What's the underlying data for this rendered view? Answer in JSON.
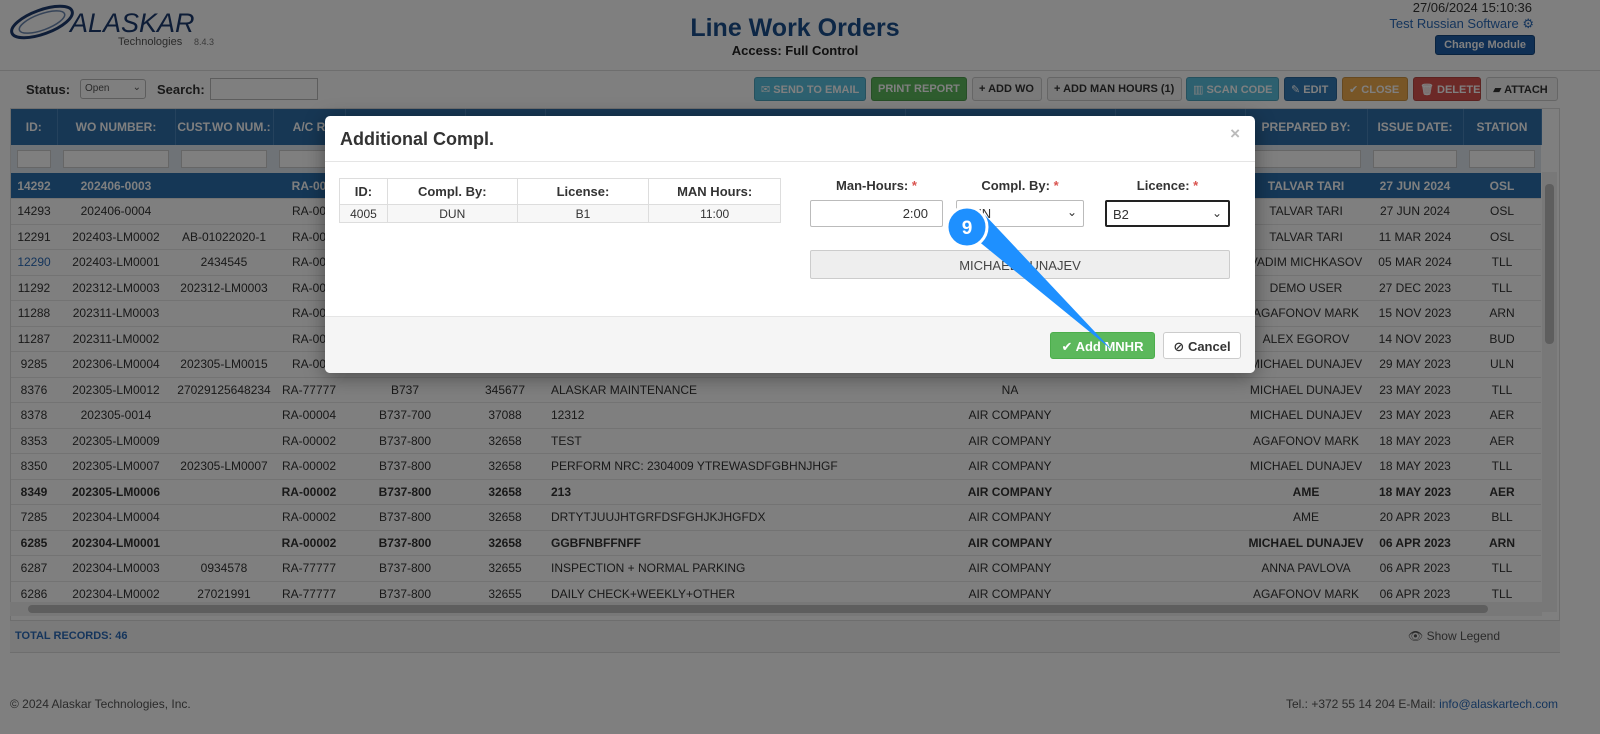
{
  "header": {
    "brand": "ALASKAR",
    "brand_sub": "Technologies",
    "version": "8.4.3",
    "title": "Line Work Orders",
    "access": "Access: Full Control",
    "datetime": "27/06/2024 15:10:36",
    "company": "Test Russian Software",
    "change_module": "Change Module"
  },
  "toolbar": {
    "status_label": "Status:",
    "status_value": "Open",
    "search_label": "Search:",
    "search_value": "",
    "send_email": "SEND TO EMAIL",
    "print_report": "PRINT REPORT",
    "add_wo": "ADD WO",
    "add_man_hours": "ADD MAN HOURS (1)",
    "scan_code": "SCAN CODE",
    "edit": "EDIT",
    "close": "CLOSE",
    "delete": "DELETE",
    "attach": "ATTACH"
  },
  "grid": {
    "columns": [
      "ID:",
      "WO NUMBER:",
      "CUST.WO NUM.:",
      "A/C R",
      "",
      "",
      "",
      "",
      "",
      "PREPARED BY:",
      "ISSUE DATE:",
      "STATION"
    ],
    "rows": [
      {
        "id": "14292",
        "wo": "202406-0003",
        "cust": "",
        "reg": "RA-00",
        "type": "",
        "msn": "",
        "desc": "",
        "company": "",
        "prepared": "TALVAR TARI",
        "date": "27 JUN 2024",
        "station": "OSL",
        "style": "selected"
      },
      {
        "id": "14293",
        "wo": "202406-0004",
        "cust": "",
        "reg": "RA-00",
        "type": "",
        "msn": "",
        "desc": "",
        "company": "",
        "prepared": "TALVAR TARI",
        "date": "27 JUN 2024",
        "station": "OSL",
        "style": ""
      },
      {
        "id": "12291",
        "wo": "202403-LM0002",
        "cust": "AB-01022020-1",
        "reg": "RA-00",
        "type": "",
        "msn": "",
        "desc": "",
        "company": "",
        "prepared": "TALVAR TARI",
        "date": "11 MAR 2024",
        "station": "OSL",
        "style": ""
      },
      {
        "id": "12290",
        "wo": "202403-LM0001",
        "cust": "2434545",
        "reg": "RA-00",
        "type": "",
        "msn": "",
        "desc": "",
        "company": "",
        "prepared": "VADIM MICHKASOV",
        "date": "05 MAR 2024",
        "station": "TLL",
        "style": "link"
      },
      {
        "id": "11292",
        "wo": "202312-LM0003",
        "cust": "202312-LM0003",
        "reg": "RA-00",
        "type": "",
        "msn": "",
        "desc": "",
        "company": "",
        "prepared": "DEMO USER",
        "date": "27 DEC 2023",
        "station": "TLL",
        "style": ""
      },
      {
        "id": "11288",
        "wo": "202311-LM0003",
        "cust": "",
        "reg": "RA-00",
        "type": "",
        "msn": "",
        "desc": "",
        "company": "",
        "prepared": "AGAFONOV MARK",
        "date": "15 NOV 2023",
        "station": "ARN",
        "style": ""
      },
      {
        "id": "11287",
        "wo": "202311-LM0002",
        "cust": "",
        "reg": "RA-00",
        "type": "",
        "msn": "",
        "desc": "",
        "company": "",
        "prepared": "ALEX EGOROV",
        "date": "14 NOV 2023",
        "station": "BUD",
        "style": ""
      },
      {
        "id": "9285",
        "wo": "202306-LM0004",
        "cust": "202305-LM0015",
        "reg": "RA-00",
        "type": "",
        "msn": "",
        "desc": "",
        "company": "",
        "prepared": "MICHAEL DUNAJEV",
        "date": "29 MAY 2023",
        "station": "ULN",
        "style": ""
      },
      {
        "id": "8376",
        "wo": "202305-LM0012",
        "cust": "27029125648234",
        "reg": "RA-77777",
        "type": "B737",
        "msn": "345677",
        "desc": "ALASKAR MAINTENANCE",
        "company": "NA",
        "prepared": "MICHAEL DUNAJEV",
        "date": "23 MAY 2023",
        "station": "TLL",
        "style": ""
      },
      {
        "id": "8378",
        "wo": "202305-0014",
        "cust": "",
        "reg": "RA-00004",
        "type": "B737-700",
        "msn": "37088",
        "desc": "12312",
        "company": "AIR COMPANY",
        "prepared": "MICHAEL DUNAJEV",
        "date": "23 MAY 2023",
        "station": "AER",
        "style": ""
      },
      {
        "id": "8353",
        "wo": "202305-LM0009",
        "cust": "",
        "reg": "RA-00002",
        "type": "B737-800",
        "msn": "32658",
        "desc": "TEST",
        "company": "AIR COMPANY",
        "prepared": "AGAFONOV MARK",
        "date": "18 MAY 2023",
        "station": "AER",
        "style": ""
      },
      {
        "id": "8350",
        "wo": "202305-LM0007",
        "cust": "202305-LM0007",
        "reg": "RA-00002",
        "type": "B737-800",
        "msn": "32658",
        "desc": "PERFORM NRC: 2304009 YTREWASDFGBHNJHGF",
        "company": "AIR COMPANY",
        "prepared": "MICHAEL DUNAJEV",
        "date": "18 MAY 2023",
        "station": "TLL",
        "style": ""
      },
      {
        "id": "8349",
        "wo": "202305-LM0006",
        "cust": "",
        "reg": "RA-00002",
        "type": "B737-800",
        "msn": "32658",
        "desc": "213",
        "company": "AIR COMPANY",
        "prepared": "AME",
        "date": "18 MAY 2023",
        "station": "AER",
        "style": "bold"
      },
      {
        "id": "7285",
        "wo": "202304-LM0004",
        "cust": "",
        "reg": "RA-00002",
        "type": "B737-800",
        "msn": "32658",
        "desc": "DRTYTJUUJHTGRFDSFGHJKJHGFDX",
        "company": "AIR COMPANY",
        "prepared": "AME",
        "date": "20 APR 2023",
        "station": "BLL",
        "style": ""
      },
      {
        "id": "6285",
        "wo": "202304-LM0001",
        "cust": "",
        "reg": "RA-00002",
        "type": "B737-800",
        "msn": "32658",
        "desc": "GGBFNBFFNFF",
        "company": "AIR COMPANY",
        "prepared": "MICHAEL DUNAJEV",
        "date": "06 APR 2023",
        "station": "ARN",
        "style": "bold"
      },
      {
        "id": "6287",
        "wo": "202304-LM0003",
        "cust": "0934578",
        "reg": "RA-77777",
        "type": "B737-800",
        "msn": "32655",
        "desc": "INSPECTION + NORMAL PARKING",
        "company": "AIR COMPANY",
        "prepared": "ANNA PAVLOVA",
        "date": "06 APR 2023",
        "station": "TLL",
        "style": ""
      },
      {
        "id": "6286",
        "wo": "202304-LM0002",
        "cust": "27021991",
        "reg": "RA-77777",
        "type": "B737-800",
        "msn": "32655",
        "desc": "DAILY CHECK+WEEKLY+OTHER",
        "company": "AIR COMPANY",
        "prepared": "AGAFONOV MARK",
        "date": "06 APR 2023",
        "station": "TLL",
        "style": ""
      }
    ],
    "total": "TOTAL RECORDS: 46",
    "legend": "Show Legend"
  },
  "footer": {
    "copyright": "© 2024 Alaskar Technologies, Inc.",
    "contact": "Tel.: +372 55 14 204 E-Mail:",
    "email": "info@alaskartech.com"
  },
  "modal": {
    "title": "Additional Compl.",
    "close_glyph": "×",
    "table_headers": [
      "ID:",
      "Compl. By:",
      "License:",
      "MAN Hours:"
    ],
    "table_rows": [
      [
        "4005",
        "DUN",
        "B1",
        "11:00"
      ]
    ],
    "man_hours_label": "Man-Hours:",
    "man_hours_value": "2:00",
    "compl_by_label": "Compl. By:",
    "compl_by_value": "DUN",
    "licence_label": "Licence:",
    "licence_value": "B2",
    "required_mark": "*",
    "person_name": "MICHAEL DUNAJEV",
    "add_label": "Add MNHR",
    "cancel_label": "Cancel"
  },
  "step_marker": {
    "number": "9",
    "color": "#1e90ff"
  }
}
